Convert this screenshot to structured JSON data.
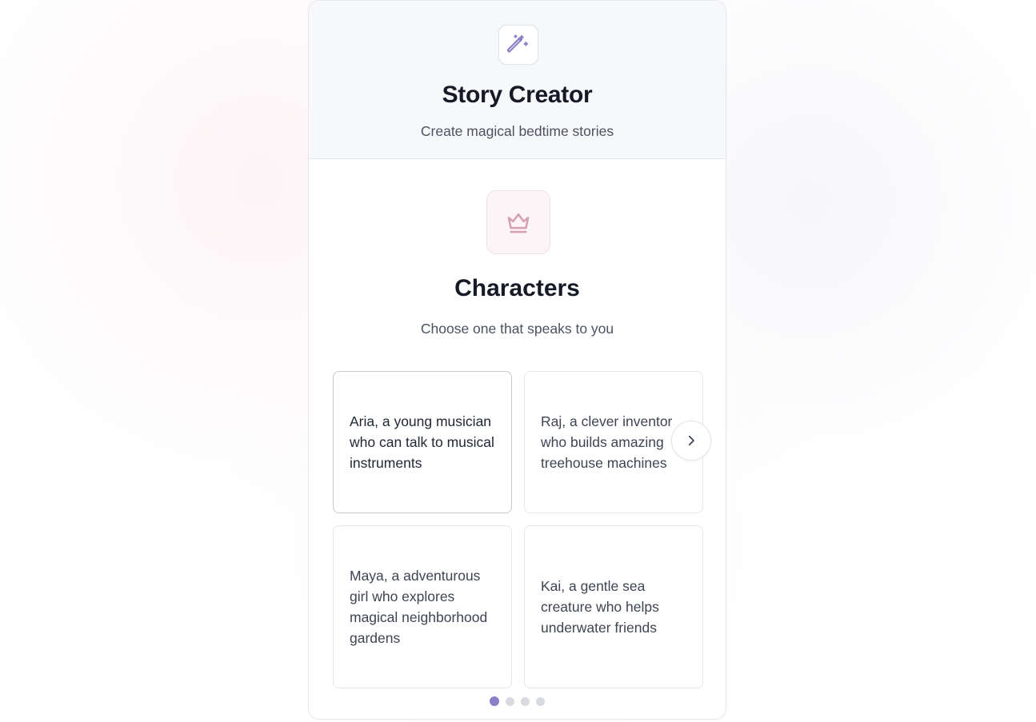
{
  "header": {
    "icon": "magic-wand-icon",
    "title": "Story Creator",
    "subtitle": "Create magical bedtime stories"
  },
  "step": {
    "icon": "crown-icon",
    "title": "Characters",
    "subtitle": "Choose one that speaks to you"
  },
  "options": [
    {
      "label": "Aria, a young musician who can talk to musical instruments",
      "selected": true
    },
    {
      "label": "Raj, a clever inventor who builds amazing treehouse machines",
      "selected": false
    },
    {
      "label": "Maya, a adventurous girl who explores magical neighborhood gardens",
      "selected": false
    },
    {
      "label": "Kai, a gentle sea creature who helps underwater friends",
      "selected": false
    }
  ],
  "carousel": {
    "next_icon": "chevron-right-icon",
    "page_count": 4,
    "active_page": 1
  },
  "colors": {
    "accent": "#8b7fc8",
    "wand_icon": "#8b7fc8",
    "crown_icon": "#d6a0b5",
    "crown_bg": "#fcf5f7",
    "header_bg": "#f7f8fa",
    "text_dark": "#151a26",
    "text_muted": "#4b5260",
    "dot_inactive": "#d9dae0"
  }
}
